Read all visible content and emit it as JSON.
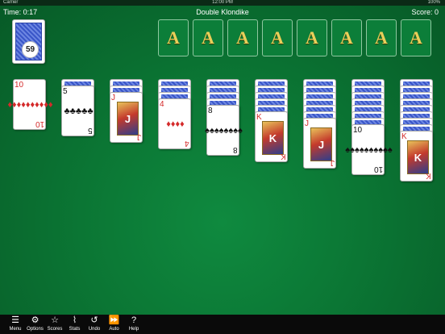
{
  "status_bar": {
    "left": "Carrier",
    "center": "12:00 PM",
    "right": "100%"
  },
  "hud": {
    "time": "Time: 0:17",
    "title": "Double Klondike",
    "score": "Score: 0"
  },
  "stock": {
    "count": "59"
  },
  "foundations": [
    "A",
    "A",
    "A",
    "A",
    "A",
    "A",
    "A",
    "A"
  ],
  "tableau": [
    {
      "face_down": 0,
      "card": {
        "rank": "10",
        "suit": "♦",
        "color": "red",
        "pips": "♦♦♦♦♦♦♦♦♦♦"
      }
    },
    {
      "face_down": 1,
      "card": {
        "rank": "5",
        "suit": "♣",
        "color": "black",
        "pips": "♣♣♣♣♣"
      }
    },
    {
      "face_down": 2,
      "card": {
        "rank": "J",
        "suit": "♦",
        "color": "red",
        "pips": "J"
      }
    },
    {
      "face_down": 3,
      "card": {
        "rank": "4",
        "suit": "♦",
        "color": "red",
        "pips": "♦♦♦♦"
      }
    },
    {
      "face_down": 4,
      "card": {
        "rank": "8",
        "suit": "♠",
        "color": "black",
        "pips": "♠♠♠♠♠♠♠♠"
      }
    },
    {
      "face_down": 5,
      "card": {
        "rank": "K",
        "suit": "♦",
        "color": "red",
        "pips": "K"
      }
    },
    {
      "face_down": 6,
      "card": {
        "rank": "J",
        "suit": "♦",
        "color": "red",
        "pips": "J"
      }
    },
    {
      "face_down": 7,
      "card": {
        "rank": "10",
        "suit": "♠",
        "color": "black",
        "pips": "♠♠♠♠♠♠♠♠♠♠"
      }
    },
    {
      "face_down": 8,
      "card": {
        "rank": "K",
        "suit": "♦",
        "color": "red",
        "pips": "K"
      }
    }
  ],
  "toolbar": [
    {
      "label": "Menu",
      "icon": "menu-icon",
      "glyph": "☰"
    },
    {
      "label": "Options",
      "icon": "gear-icon",
      "glyph": "⚙"
    },
    {
      "label": "Scores",
      "icon": "star-icon",
      "glyph": "☆"
    },
    {
      "label": "Stats",
      "icon": "stats-icon",
      "glyph": "⌇"
    },
    {
      "label": "Undo",
      "icon": "undo-icon",
      "glyph": "↺"
    },
    {
      "label": "Auto",
      "icon": "fast-forward-icon",
      "glyph": "⏩"
    },
    {
      "label": "Help",
      "icon": "help-icon",
      "glyph": "?"
    }
  ],
  "colors": {
    "felt": "#0b7634",
    "foundation_letter": "#e9cf5a",
    "card_red": "#d42a2a",
    "card_back": "#3a56c8"
  }
}
